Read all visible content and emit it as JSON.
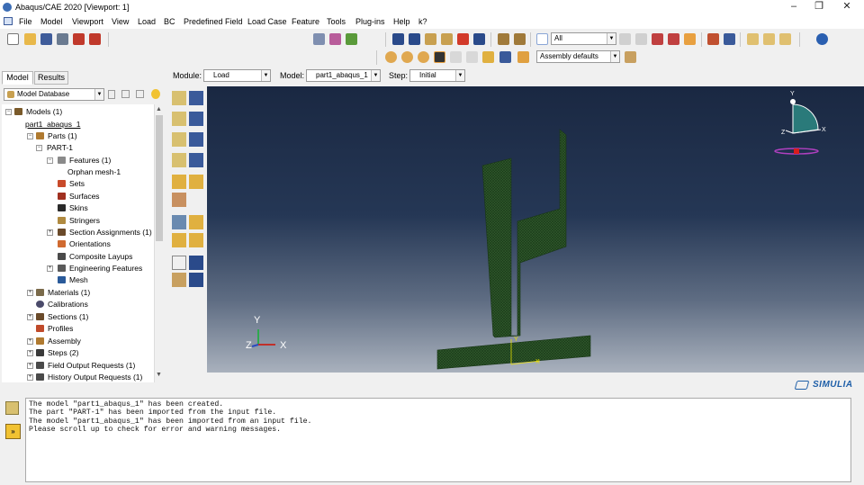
{
  "window": {
    "title": "Abaqus/CAE 2020 [Viewport: 1]",
    "minimize": "–",
    "maximize": "❐",
    "close": "✕"
  },
  "menu": [
    "File",
    "Model",
    "Viewport",
    "View",
    "Load",
    "BC",
    "Predefined Field",
    "Load Case",
    "Feature",
    "Tools",
    "Plug-ins",
    "Help",
    "k?"
  ],
  "toolbar": {
    "selection_filter": "All",
    "render_style": "Assembly defaults"
  },
  "context": {
    "module_label": "Module:",
    "module_value": "Load",
    "model_label": "Model:",
    "model_value": "part1_abaqus_1",
    "step_label": "Step:",
    "step_value": "Initial"
  },
  "tabs": [
    "Model",
    "Results"
  ],
  "tree": {
    "database_label": "Model Database",
    "nodes": [
      "Models (1)",
      "part1_abaqus_1",
      "Parts (1)",
      "PART-1",
      "Features (1)",
      "Orphan mesh-1",
      "Sets",
      "Surfaces",
      "Skins",
      "Stringers",
      "Section Assignments (1)",
      "Orientations",
      "Composite Layups",
      "Engineering Features",
      "Mesh",
      "Materials (1)",
      "Calibrations",
      "Sections (1)",
      "Profiles",
      "Assembly",
      "Steps (2)",
      "Field Output Requests (1)",
      "History Output Requests (1)"
    ]
  },
  "viewport": {
    "triad_y": "Y",
    "triad_z": "Z",
    "triad_x": "X",
    "nav_y": "Y",
    "nav_z": "Z",
    "nav_x": "X",
    "local_y": "Y",
    "local_x": "X",
    "brand": "SIMULIA"
  },
  "messages": [
    "The model \"part1_abaqus_1\" has been created.",
    "The part \"PART-1\" has been imported from the input file.",
    "The model \"part1_abaqus_1\" has been imported from an input file.",
    "Please scroll up to check for error and warning messages."
  ],
  "colors": {
    "mesh": "#2f5a2c",
    "viewport_top": "#1a2842",
    "viewport_bottom": "#a9b1bd",
    "accent": "#f5a623"
  }
}
